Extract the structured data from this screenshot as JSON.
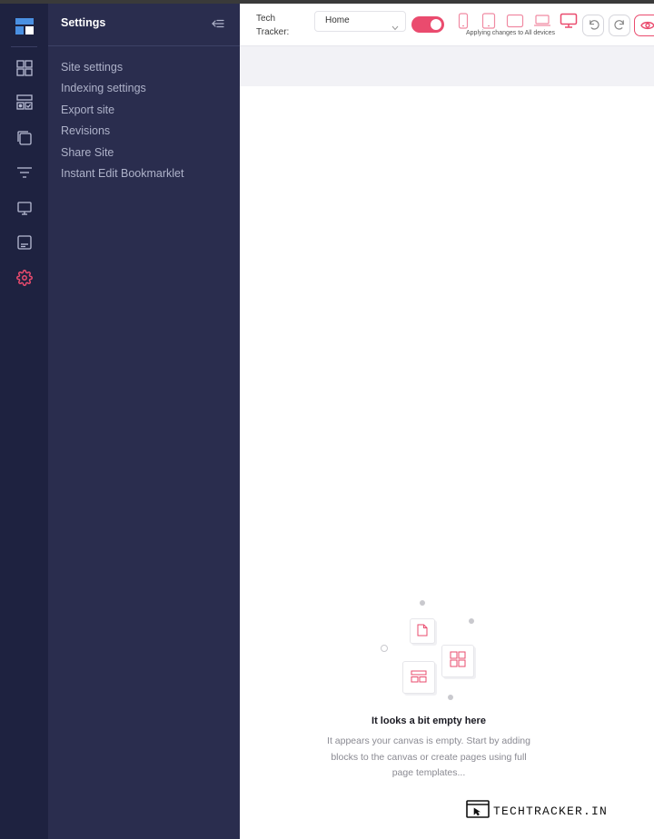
{
  "colors": {
    "rail_bg": "#1e2240",
    "panel_bg": "#2a2d4e",
    "accent": "#ea4b6e",
    "menu_text": "#aeb2c9",
    "rail_icon": "#b8bcd4"
  },
  "rail": {
    "logo": "builder-logo-icon",
    "items": [
      {
        "icon": "blocks-grid-icon",
        "active": false
      },
      {
        "icon": "components-icon",
        "active": false
      },
      {
        "icon": "pages-copy-icon",
        "active": false
      },
      {
        "icon": "filter-lines-icon",
        "active": false
      },
      {
        "icon": "monitor-icon",
        "active": false
      },
      {
        "icon": "layout-panel-icon",
        "active": false
      },
      {
        "icon": "gear-icon",
        "active": true
      }
    ]
  },
  "panel": {
    "title": "Settings",
    "collapse_icon": "collapse-left-icon",
    "items": [
      {
        "label": "Site settings"
      },
      {
        "label": "Indexing settings"
      },
      {
        "label": "Export site"
      },
      {
        "label": "Revisions"
      },
      {
        "label": "Share Site"
      },
      {
        "label": "Instant Edit Bookmarklet"
      }
    ]
  },
  "toolbar": {
    "site_name": "Tech Tracker:",
    "page_select": "Home",
    "sync_toggle_on": true,
    "devices": [
      "mobile-icon",
      "tablet-icon",
      "tablet-landscape-icon",
      "laptop-icon",
      "desktop-icon"
    ],
    "active_device": "desktop-icon",
    "apply_note": "Applying changes to All devices",
    "undo_icon": "undo-icon",
    "redo_icon": "redo-icon",
    "preview_icon": "eye-icon"
  },
  "empty_state": {
    "title": "It looks a bit empty here",
    "description": "It appears your canvas is empty. Start by adding blocks to the canvas or create pages using full page templates..."
  },
  "watermark": {
    "text": "TECHTRACKER.IN",
    "icon": "browser-cursor-icon"
  }
}
